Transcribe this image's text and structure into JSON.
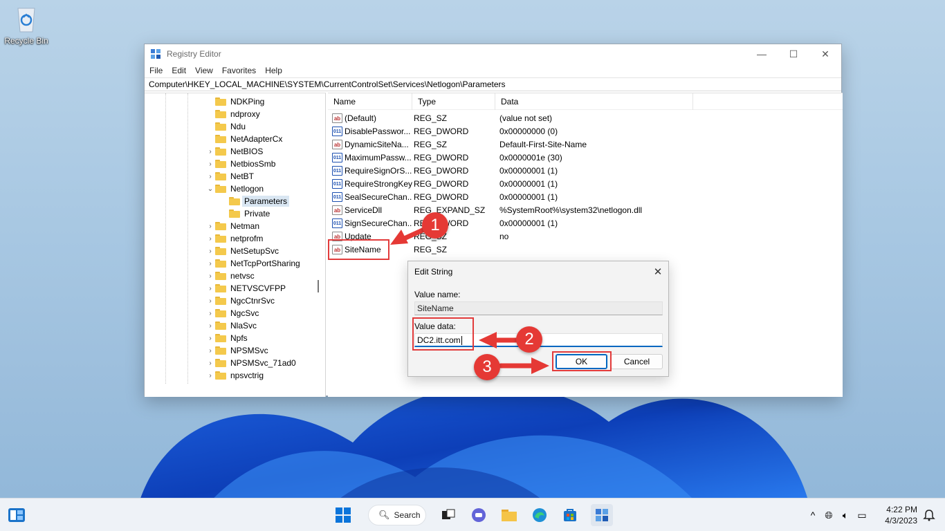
{
  "desktop": {
    "recycle_bin_label": "Recycle Bin"
  },
  "window": {
    "title": "Registry Editor",
    "menu": [
      "File",
      "Edit",
      "View",
      "Favorites",
      "Help"
    ],
    "address": "Computer\\HKEY_LOCAL_MACHINE\\SYSTEM\\CurrentControlSet\\Services\\Netlogon\\Parameters"
  },
  "tree": {
    "items": [
      {
        "label": "NDKPing",
        "chevron": ""
      },
      {
        "label": "ndproxy",
        "chevron": ""
      },
      {
        "label": "Ndu",
        "chevron": ""
      },
      {
        "label": "NetAdapterCx",
        "chevron": ""
      },
      {
        "label": "NetBIOS",
        "chevron": "›"
      },
      {
        "label": "NetbiosSmb",
        "chevron": "›"
      },
      {
        "label": "NetBT",
        "chevron": "›"
      },
      {
        "label": "Netlogon",
        "chevron": "⌄"
      },
      {
        "label": "Parameters",
        "chevron": ""
      },
      {
        "label": "Private",
        "chevron": ""
      },
      {
        "label": "Netman",
        "chevron": "›"
      },
      {
        "label": "netprofm",
        "chevron": "›"
      },
      {
        "label": "NetSetupSvc",
        "chevron": "›"
      },
      {
        "label": "NetTcpPortSharing",
        "chevron": "›"
      },
      {
        "label": "netvsc",
        "chevron": "›"
      },
      {
        "label": "NETVSCVFPP",
        "chevron": "›"
      },
      {
        "label": "NgcCtnrSvc",
        "chevron": "›"
      },
      {
        "label": "NgcSvc",
        "chevron": "›"
      },
      {
        "label": "NlaSvc",
        "chevron": "›"
      },
      {
        "label": "Npfs",
        "chevron": "›"
      },
      {
        "label": "NPSMSvc",
        "chevron": "›"
      },
      {
        "label": "NPSMSvc_71ad0",
        "chevron": "›"
      },
      {
        "label": "npsvctrig",
        "chevron": "›"
      }
    ]
  },
  "list": {
    "headers": [
      "Name",
      "Type",
      "Data"
    ],
    "rows": [
      {
        "name": "(Default)",
        "type": "REG_SZ",
        "data": "(value not set)",
        "icon": "ab"
      },
      {
        "name": "DisablePasswor...",
        "type": "REG_DWORD",
        "data": "0x00000000 (0)",
        "icon": "011"
      },
      {
        "name": "DynamicSiteNa...",
        "type": "REG_SZ",
        "data": "Default-First-Site-Name",
        "icon": "ab"
      },
      {
        "name": "MaximumPassw...",
        "type": "REG_DWORD",
        "data": "0x0000001e (30)",
        "icon": "011"
      },
      {
        "name": "RequireSignOrS...",
        "type": "REG_DWORD",
        "data": "0x00000001 (1)",
        "icon": "011"
      },
      {
        "name": "RequireStrongKey",
        "type": "REG_DWORD",
        "data": "0x00000001 (1)",
        "icon": "011"
      },
      {
        "name": "SealSecureChan...",
        "type": "REG_DWORD",
        "data": "0x00000001 (1)",
        "icon": "011"
      },
      {
        "name": "ServiceDll",
        "type": "REG_EXPAND_SZ",
        "data": "%SystemRoot%\\system32\\netlogon.dll",
        "icon": "ab"
      },
      {
        "name": "SignSecureChan...",
        "type": "REG_DWORD",
        "data": "0x00000001 (1)",
        "icon": "011"
      },
      {
        "name": "Update",
        "type": "REG_SZ",
        "data": "no",
        "icon": "ab"
      },
      {
        "name": "SiteName",
        "type": "REG_SZ",
        "data": "",
        "icon": "ab"
      }
    ]
  },
  "dialog": {
    "title": "Edit String",
    "value_name_label": "Value name:",
    "value_name": "SiteName",
    "value_data_label": "Value data:",
    "value_data": "DC2.itt.com",
    "ok_label": "OK",
    "cancel_label": "Cancel"
  },
  "callouts": [
    "1",
    "2",
    "3"
  ],
  "taskbar": {
    "search_label": "Search",
    "time": "4:22 PM",
    "date": "4/3/2023"
  },
  "colors": {
    "accent": "#0067c0",
    "callout_red": "#e53935",
    "highlight": "#e23b3b"
  }
}
